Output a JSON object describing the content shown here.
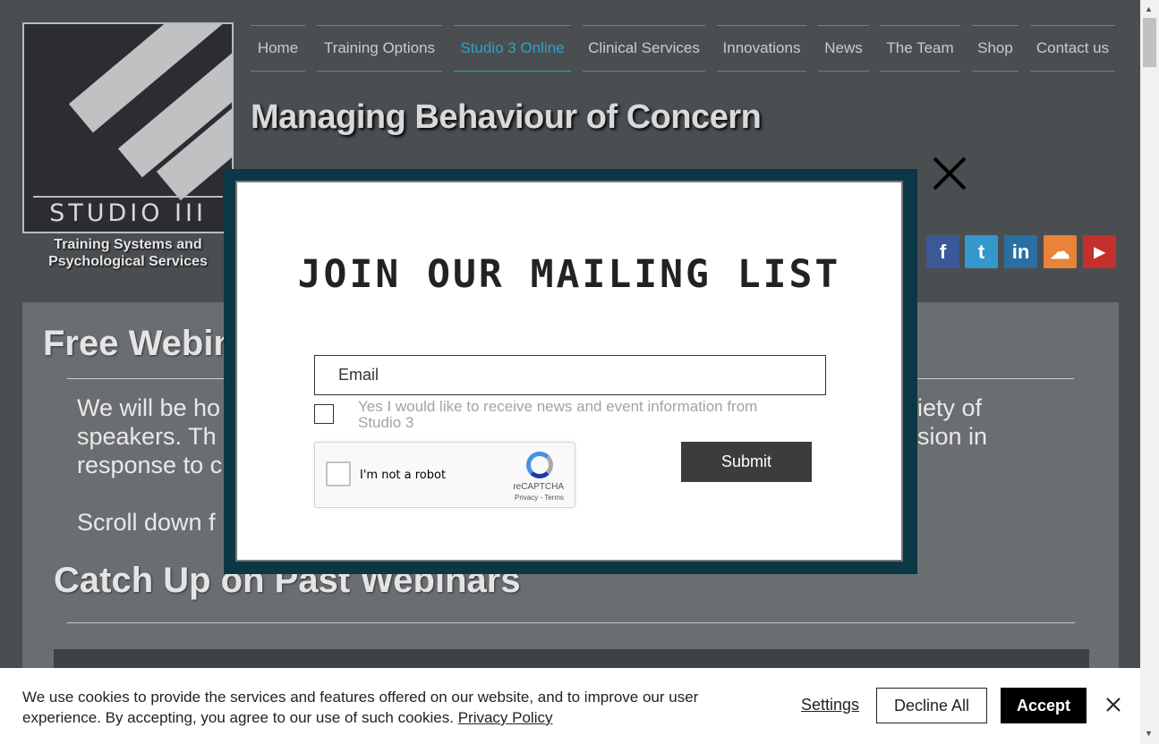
{
  "logo": {
    "text": "STUDIO III",
    "tagline": "Training Systems and Psychological Services"
  },
  "nav": {
    "items": [
      {
        "label": "Home",
        "active": false
      },
      {
        "label": "Training Options",
        "active": false
      },
      {
        "label": "Studio 3 Online",
        "active": true
      },
      {
        "label": "Clinical Services",
        "active": false
      },
      {
        "label": "Innovations",
        "active": false
      },
      {
        "label": "News",
        "active": false
      },
      {
        "label": "The Team",
        "active": false
      },
      {
        "label": "Shop",
        "active": false
      },
      {
        "label": "Contact us",
        "active": false
      }
    ]
  },
  "header": {
    "title": "Managing Behaviour of Concern"
  },
  "social": [
    {
      "icon": "facebook-icon",
      "glyph": "f",
      "color": "#3b5998"
    },
    {
      "icon": "twitter-icon",
      "glyph": "t",
      "color": "#3399cc"
    },
    {
      "icon": "linkedin-icon",
      "glyph": "in",
      "color": "#2a6fa3"
    },
    {
      "icon": "soundcloud-icon",
      "glyph": "☁",
      "color": "#e8833a"
    },
    {
      "icon": "youtube-icon",
      "glyph": "▶",
      "color": "#c4302b"
    }
  ],
  "main": {
    "free_webinars_heading": "Free Webin",
    "para_line1_left": "We will be ho",
    "para_line1_right": "iety of",
    "para_line2_left": "speakers. Th",
    "para_line2_right": "sion in",
    "para_line3_left": "response to c",
    "scroll_text": "Scroll down f",
    "past_heading": "Catch Up on Past Webinars"
  },
  "popup": {
    "title": "JOIN OUR MAILING LIST",
    "email_placeholder": "Email",
    "optin_label": "Yes I would like to receive news and event information from Studio 3",
    "recaptcha_label": "I'm not a robot",
    "recaptcha_brand": "reCAPTCHA",
    "recaptcha_terms": "Privacy - Terms",
    "submit_label": "Submit"
  },
  "cookie": {
    "text": "We use cookies to provide the services and features offered on our website, and to improve our user experience. By accepting, you agree to our use of such cookies.",
    "policy_link": "Privacy Policy",
    "settings_label": "Settings",
    "decline_label": "Decline All",
    "accept_label": "Accept"
  },
  "colors": {
    "accent": "#2aa3c8",
    "popup_frame": "#0c3745",
    "background": "#4b4e51"
  }
}
